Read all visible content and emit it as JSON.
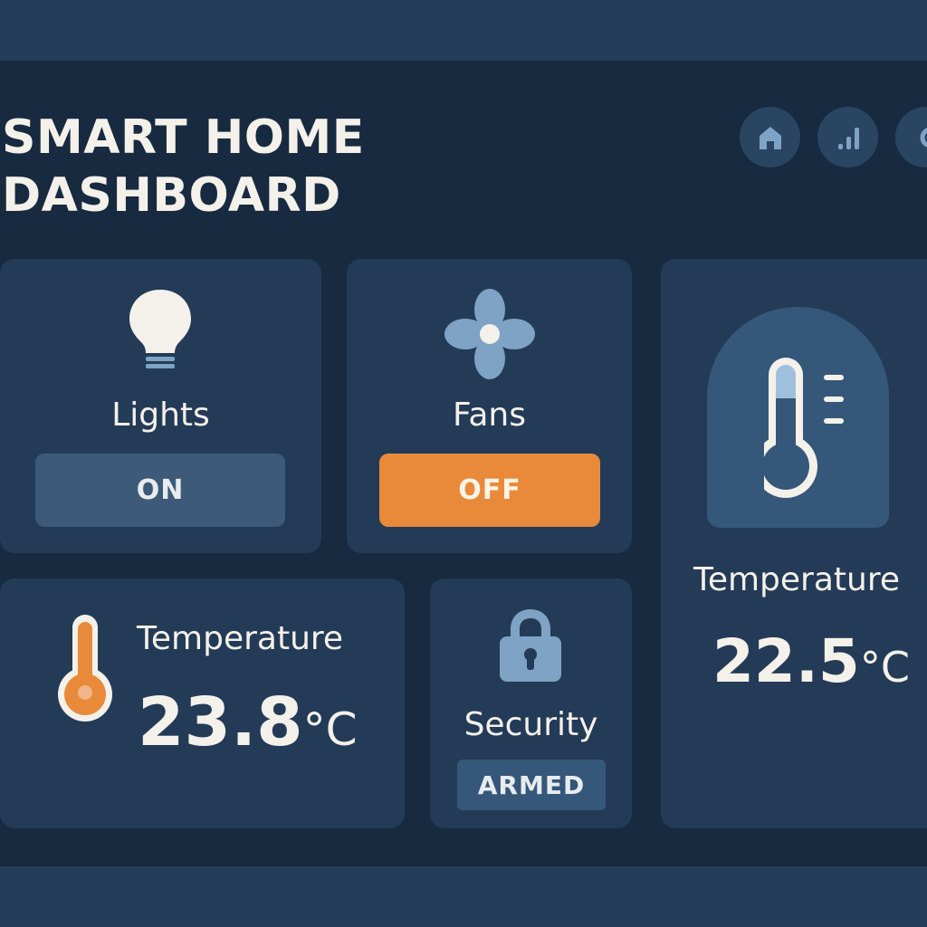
{
  "header": {
    "title_line1": "SMART HOME",
    "title_line2": "DASHBOARD",
    "icons": [
      "home-icon",
      "signal-icon",
      "search-icon"
    ]
  },
  "cards": {
    "lights": {
      "label": "Lights",
      "state": "ON",
      "icon": "lightbulb-icon"
    },
    "fans": {
      "label": "Fans",
      "state": "OFF",
      "icon": "fan-icon"
    },
    "temperature_large": {
      "label": "Temperature",
      "value": "22.5",
      "unit": "°C",
      "icon": "thermometer-icon"
    },
    "temperature_small": {
      "label": "Temperature",
      "value": "23.8",
      "unit": "°C",
      "icon": "thermometer-icon"
    },
    "security": {
      "label": "Security",
      "state": "ARMED",
      "icon": "lock-icon"
    }
  },
  "colors": {
    "accent_orange": "#e88a3a",
    "background": "#172a40",
    "card": "#233b57",
    "on_button": "#3d5a78",
    "icon_blue": "#7ea3c4",
    "text": "#f4f1ea"
  }
}
